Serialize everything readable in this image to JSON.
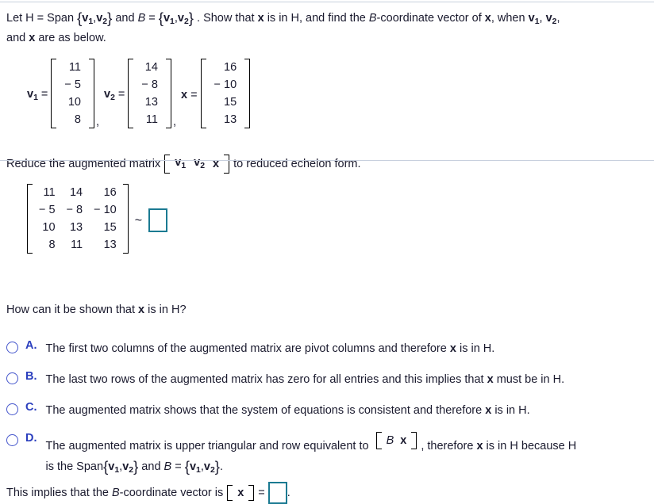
{
  "problem": {
    "statement_part1": "Let H = Span",
    "set1": "{v1,v2}",
    "statement_part2": "and",
    "b_letter": "B",
    "equals": "=",
    "set2": "{v1,v2}",
    "statement_part3": ". Show that",
    "x_var": "x",
    "statement_part4": "is in H, and find the",
    "b_coordinate": "B",
    "statement_part5": "-coordinate vector of",
    "statement_part6": ", when",
    "v1_label": "v",
    "v2_label": "v",
    "statement_line2": "and x are as below.",
    "line1_full": "Let H = Span {v1,v2} and B = {v1,v2}. Show that x is in H, and find the B-coordinate vector of x, when v1, v2,",
    "line2_full": "and x are as below."
  },
  "vectors": [
    {
      "name": "v",
      "subscript": "1",
      "values": [
        "11",
        "− 5",
        "10",
        "8"
      ]
    },
    {
      "name": "v",
      "subscript": "2",
      "values": [
        "14",
        "− 8",
        "13",
        "11"
      ]
    },
    {
      "name": "x",
      "subscript": "",
      "values": [
        "16",
        "− 10",
        "15",
        "13"
      ]
    }
  ],
  "reduce_instruction": {
    "prefix": "Reduce the augmented matrix",
    "bracket_items": [
      "v1",
      "v2",
      "x"
    ],
    "suffix": "to reduced echelon form."
  },
  "augmented_matrix": {
    "rows": [
      [
        "11",
        "14",
        "16"
      ],
      [
        "− 5",
        "− 8",
        "− 10"
      ],
      [
        "10",
        "13",
        "15"
      ],
      [
        "8",
        "11",
        "13"
      ]
    ],
    "relation_symbol": "~",
    "answer_value": ""
  },
  "question": "How can it be shown that x is in H?",
  "options": [
    {
      "letter": "A.",
      "text_before": "The first two columns of the augmented matrix are pivot columns and therefore",
      "bold_var": "x",
      "text_after": "is in H.",
      "full_text": "The first two columns of the augmented matrix are pivot columns and therefore x is in H."
    },
    {
      "letter": "B.",
      "text_before": "The last two rows of the augmented matrix has zero for all entries and this implies that",
      "bold_var": "x",
      "text_after": "must be in H.",
      "full_text": "The last two rows of the augmented matrix has zero for all entries and this implies that x must be in H."
    },
    {
      "letter": "C.",
      "text_before": "The augmented matrix shows that the system of equations is consistent and therefore",
      "bold_var": "x",
      "text_after": "is in H.",
      "full_text": "The augmented matrix shows that the system of equations is consistent and therefore x is in H."
    },
    {
      "letter": "D.",
      "text_before": "The augmented matrix is upper triangular and row equivalent to",
      "bracket_content": "B x",
      "text_after": ", therefore x is in H because H",
      "line2_prefix": "is the Span",
      "line2_set1": "{v1,v2}",
      "line2_mid": "and B =",
      "line2_set2": "{v1,v2}",
      "line2_suffix": ".",
      "full_text": "The augmented matrix is upper triangular and row equivalent to [ B x ], therefore x is in H because H is the Span{v1,v2} and B = {v1,v2}."
    }
  ],
  "final_line": {
    "prefix": "This implies that the",
    "b_italic": "B",
    "suffix": "-coordinate vector is",
    "bracket_var": "x",
    "equals": "=",
    "answer_value": "",
    "period": ".",
    "full_text": "This implies that the B-coordinate vector is [ x ] = ."
  },
  "colors": {
    "divider": "#c8d0de",
    "radio_border": "#4455cc",
    "option_letter": "#2b3fbe",
    "answer_box_border": "#1b7a92",
    "text": "#1a1a2e"
  }
}
